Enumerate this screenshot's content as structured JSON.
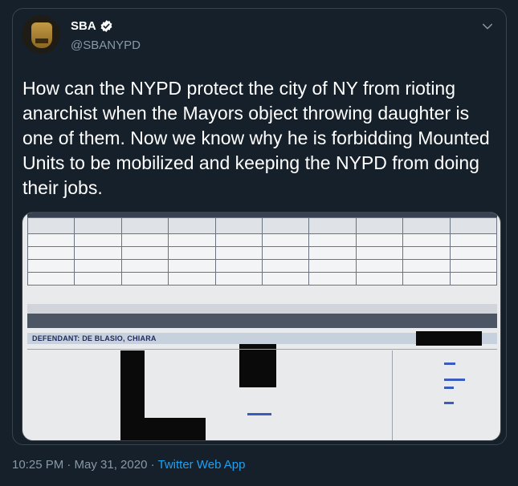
{
  "tweet": {
    "display_name": "SBA",
    "handle": "@SBANYPD",
    "text": "How can the NYPD protect the city of NY from rioting anarchist when the Mayors object throwing daughter is one of them. Now we know why he is forbidding Mounted Units to be mobilized and keeping the NYPD from doing their jobs.",
    "timestamp": "10:25 PM · May 31, 2020",
    "separator": " · ",
    "source": "Twitter Web App"
  },
  "media": {
    "defendant_label": "DEFENDANT: DE BLASIO, CHIARA"
  },
  "icons": {
    "avatar": "police-badge",
    "verified": "verified-check-icon",
    "menu": "chevron-down-icon"
  },
  "colors": {
    "background": "#15202b",
    "border": "#38444d",
    "secondary_text": "#8899a6",
    "link": "#1da1f2",
    "verified": "#ffffff"
  }
}
